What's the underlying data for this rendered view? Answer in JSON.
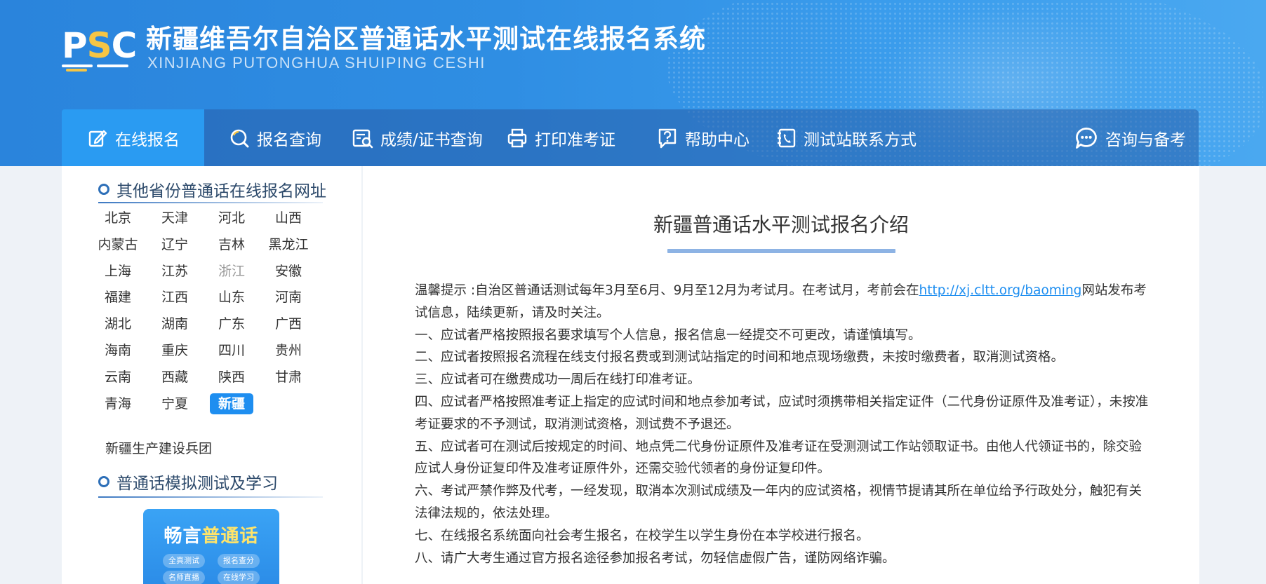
{
  "header": {
    "logo_text_p": "P",
    "logo_text_s": "S",
    "logo_text_c": "C",
    "title": "新疆维吾尔自治区普通话水平测试在线报名系统",
    "subtitle": "XINJIANG PUTONGHUA SHUIPING CESHI"
  },
  "nav": {
    "items": [
      {
        "label": "在线报名",
        "icon": "edit-icon"
      },
      {
        "label": "报名查询",
        "icon": "search-icon"
      },
      {
        "label": "成绩/证书查询",
        "icon": "certificate-search-icon"
      },
      {
        "label": "打印准考证",
        "icon": "printer-icon"
      },
      {
        "label": "帮助中心",
        "icon": "help-icon"
      },
      {
        "label": "测试站联系方式",
        "icon": "phone-icon"
      },
      {
        "label": "咨询与备考",
        "icon": "chat-icon"
      }
    ]
  },
  "sidebar": {
    "section1_title": "其他省份普通话在线报名网址",
    "provinces": [
      "北京",
      "天津",
      "河北",
      "山西",
      "内蒙古",
      "辽宁",
      "吉林",
      "黑龙江",
      "上海",
      "江苏",
      "浙江",
      "安徽",
      "福建",
      "江西",
      "山东",
      "河南",
      "湖北",
      "湖南",
      "广东",
      "广西",
      "海南",
      "重庆",
      "四川",
      "贵州",
      "云南",
      "西藏",
      "陕西",
      "甘肃",
      "青海",
      "宁夏",
      "新疆"
    ],
    "active_province": "新疆",
    "muted_province": "浙江",
    "bingtuan": "新疆生产建设兵团",
    "section2_title": "普通话模拟测试及学习",
    "promo": {
      "title_a": "畅言",
      "title_b": "普通话",
      "tags": [
        "全真测试",
        "报名查分",
        "名师直播",
        "在线学习"
      ]
    }
  },
  "main": {
    "title": "新疆普通话水平测试报名介绍",
    "notice_prefix": "温馨提示 :自治区普通话测试每年3月至6月、9月至12月为考试月。在考试月，考前会在",
    "notice_link": "http://xj.cltt.org/baoming",
    "notice_suffix": "网站发布考试信息，陆续更新，请及时关注。",
    "rules": [
      "一、应试者严格按照报名要求填写个人信息，报名信息一经提交不可更改，请谨慎填写。",
      "二、应试者按照报名流程在线支付报名费或到测试站指定的时间和地点现场缴费，未按时缴费者，取消测试资格。",
      "三、应试者可在缴费成功一周后在线打印准考证。",
      "四、应试者严格按照准考证上指定的应试时间和地点参加考试，应试时须携带相关指定证件（二代身份证原件及准考证），未按准考证要求的不予测试，取消测试资格，测试费不予退还。",
      "五、应试者可在测试后按规定的时间、地点凭二代身份证原件及准考证在受测测试工作站领取证书。由他人代领证书的，除交验应试人身份证复印件及准考证原件外，还需交验代领者的身份证复印件。",
      "六、考试严禁作弊及代考，一经发现，取消本次测试成绩及一年内的应试资格，视情节提请其所在单位给予行政处分，触犯有关法律法规的，依法处理。",
      "七、在线报名系统面向社会考生报名，在校学生以学生身份在本学校进行报名。",
      "八、请广大考生通过官方报名途径参加报名考试，勿轻信虚假广告，谨防网络诈骗。"
    ]
  }
}
